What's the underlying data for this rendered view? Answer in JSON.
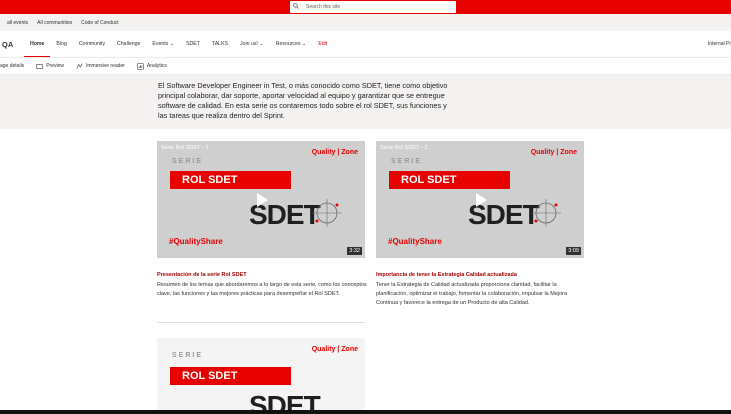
{
  "search": {
    "placeholder": "Search this site"
  },
  "global_links": [
    "all events",
    "All communities",
    "Code of Conduct"
  ],
  "site": {
    "name": "QA",
    "right_label": "Internal Pr"
  },
  "nav": [
    {
      "label": "Home",
      "active": true
    },
    {
      "label": "Blog"
    },
    {
      "label": "Community"
    },
    {
      "label": "Challenge"
    },
    {
      "label": "Events",
      "dropdown": true
    },
    {
      "label": "SDET"
    },
    {
      "label": "TALKS"
    },
    {
      "label": "Join us!",
      "dropdown": true
    },
    {
      "label": "Resources",
      "dropdown": true
    },
    {
      "label": "Edit",
      "edit": true
    }
  ],
  "commands": {
    "page_details": "age details",
    "preview": "Preview",
    "immersive": "Immersive reader",
    "analytics": "Analytics"
  },
  "intro": {
    "text": "El Software Developer Engineer in Test, o más conocido como SDET, tiene como objetivo principal colaborar, dar soporte, aportar velocidad al equipo y garantizar que se entregue software de calidad. En esta serie os contaremos todo sobre el rol SDET, sus funciones y las tareas que realiza dentro del Sprint."
  },
  "videos": [
    {
      "title": "Serie Rol SDET - 1",
      "brand": "Quality | Zone",
      "serie": "SERIE",
      "rol": "ROL SDET",
      "sdet": "SDET",
      "hashtag": "#QualityShare",
      "duration": "3:32",
      "card_title": "Presentación de la serie Rol SDET",
      "card_desc": "Resumen de los temas que abordaremos a lo largo de esta serie, como los conceptos clave, las funciones y las mejores prácticas para desempeñar el Rol SDET."
    },
    {
      "title": "Serie Rol SDET - 2",
      "brand": "Quality | Zone",
      "serie": "SERIE",
      "rol": "ROL SDET",
      "sdet": "SDET",
      "hashtag": "#QualityShare",
      "duration": "3:09",
      "card_title": "Importancia de tener la Estrategia Calidad actualizada",
      "card_desc": "Tener la Estrategia de Calidad actualizada proporciona claridad, facilitar la planificación, optimizar el trabajo, fomentar la colaboración, impulsar la Mejora Continua y favorece la entrega de un Producto de alta Calidad."
    },
    {
      "brand": "Quality | Zone",
      "serie": "SERIE",
      "rol": "ROL SDET",
      "sdet": "SDET"
    }
  ],
  "colors": {
    "accent": "#e60000",
    "card_title": "#a80000"
  }
}
